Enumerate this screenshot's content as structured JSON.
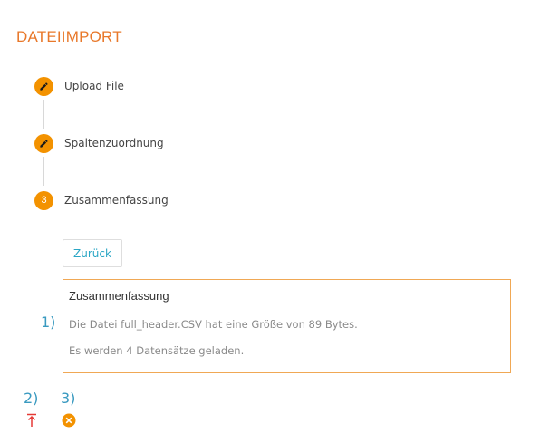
{
  "page": {
    "title": "DATEIIMPORT"
  },
  "stepper": {
    "steps": [
      {
        "label": "Upload File",
        "state": "edit",
        "icon": "pencil-icon"
      },
      {
        "label": "Spaltenzuordnung",
        "state": "edit",
        "icon": "pencil-icon"
      },
      {
        "label": "Zusammenfassung",
        "state": "active",
        "number": "3"
      }
    ]
  },
  "actions": {
    "back_label": "Zurück"
  },
  "summary": {
    "title": "Zusammenfassung",
    "lines": [
      "Die Datei full_header.CSV hat eine Größe von 89 Bytes.",
      "Es werden 4 Datensätze geladen."
    ]
  },
  "annotations": {
    "a1": "1)",
    "a2": "2)",
    "a3": "3)"
  },
  "icons": {
    "upload": "upload-arrow-icon",
    "cancel": "cancel-circle-icon"
  },
  "colors": {
    "accent_orange": "#f39200",
    "title_orange": "#e8782a",
    "link_blue": "#2aa6c5",
    "annotation_blue": "#3a9ac0",
    "upload_red": "#e53935"
  }
}
